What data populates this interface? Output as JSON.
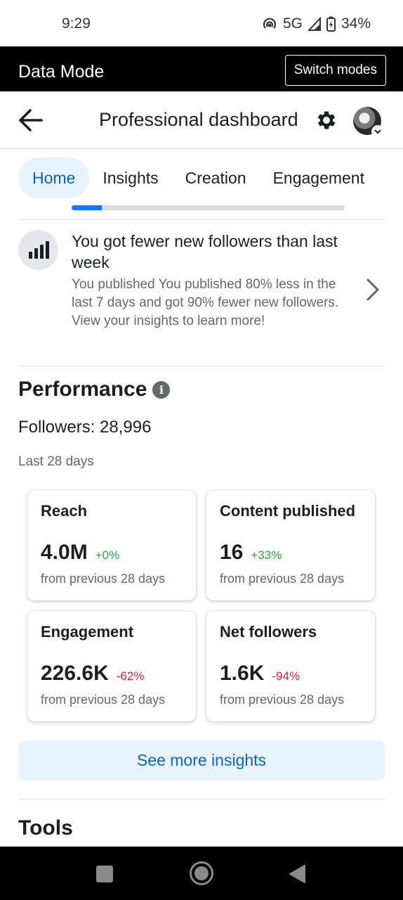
{
  "status_bar": {
    "time": "9:29",
    "network": "5G",
    "battery": "34%"
  },
  "data_mode": {
    "label": "Data Mode",
    "switch_label": "Switch modes"
  },
  "header": {
    "title": "Professional dashboard"
  },
  "tabs": [
    {
      "label": "Home",
      "active": true
    },
    {
      "label": "Insights",
      "active": false
    },
    {
      "label": "Creation",
      "active": false
    },
    {
      "label": "Engagement",
      "active": false
    }
  ],
  "progress": {
    "value": 0.11
  },
  "insight": {
    "title": "You got fewer new followers than last week",
    "body": "You published You published 80% less in the last 7 days and got 90% fewer new followers. View your insights to learn more!"
  },
  "performance": {
    "title": "Performance",
    "followers": "Followers: 28,996",
    "range": "Last 28 days",
    "cards": [
      {
        "label": "Reach",
        "value": "4.0M",
        "delta": "+0%",
        "trend": "up",
        "sub": "from previous 28 days"
      },
      {
        "label": "Content published",
        "value": "16",
        "delta": "+33%",
        "trend": "up",
        "sub": "from previous 28 days"
      },
      {
        "label": "Engagement",
        "value": "226.6K",
        "delta": "-62%",
        "trend": "down",
        "sub": "from previous 28 days"
      },
      {
        "label": "Net followers",
        "value": "1.6K",
        "delta": "-94%",
        "trend": "down",
        "sub": "from previous 28 days"
      }
    ],
    "see_more_label": "See more insights"
  },
  "tools": {
    "title": "Tools"
  },
  "colors": {
    "accent": "#0a66c2",
    "positive": "#31a24c",
    "negative": "#e41e3f"
  }
}
